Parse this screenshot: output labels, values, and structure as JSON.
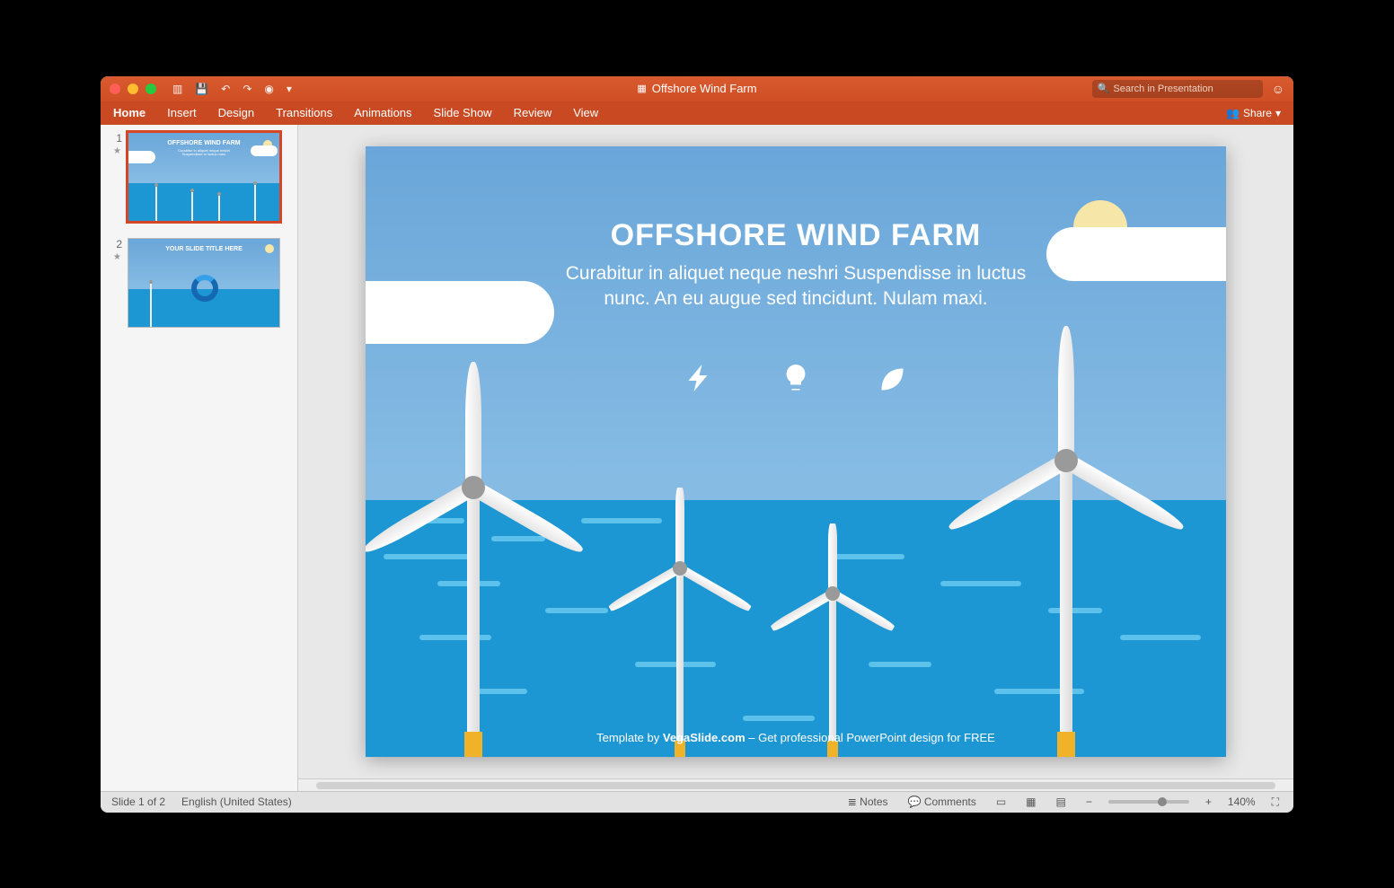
{
  "window": {
    "title": "Offshore Wind Farm"
  },
  "search": {
    "placeholder": "Search in Presentation"
  },
  "ribbon": {
    "tabs": [
      "Home",
      "Insert",
      "Design",
      "Transitions",
      "Animations",
      "Slide Show",
      "Review",
      "View"
    ],
    "share": "Share"
  },
  "thumbs": {
    "slides": [
      {
        "num": "1",
        "title": "OFFSHORE WIND FARM"
      },
      {
        "num": "2",
        "title": "YOUR SLIDE TITLE HERE"
      }
    ]
  },
  "slide": {
    "title": "OFFSHORE WIND FARM",
    "subtitle": "Curabitur in aliquet neque neshri Suspendisse in luctus nunc. An eu augue sed tincidunt. Nulam maxi.",
    "footer_pre": "Template by ",
    "footer_brand": "VegaSlide.com",
    "footer_post": " – Get professional PowerPoint design for FREE",
    "icons": [
      "bolt-icon",
      "bulb-icon",
      "leaf-icon"
    ]
  },
  "status": {
    "slide_info": "Slide 1 of 2",
    "language": "English (United States)",
    "notes": "Notes",
    "comments": "Comments",
    "zoom": "140%"
  },
  "colors": {
    "accent": "#d04f24",
    "sea": "#1d97d4",
    "sky": "#6aa6d9"
  }
}
